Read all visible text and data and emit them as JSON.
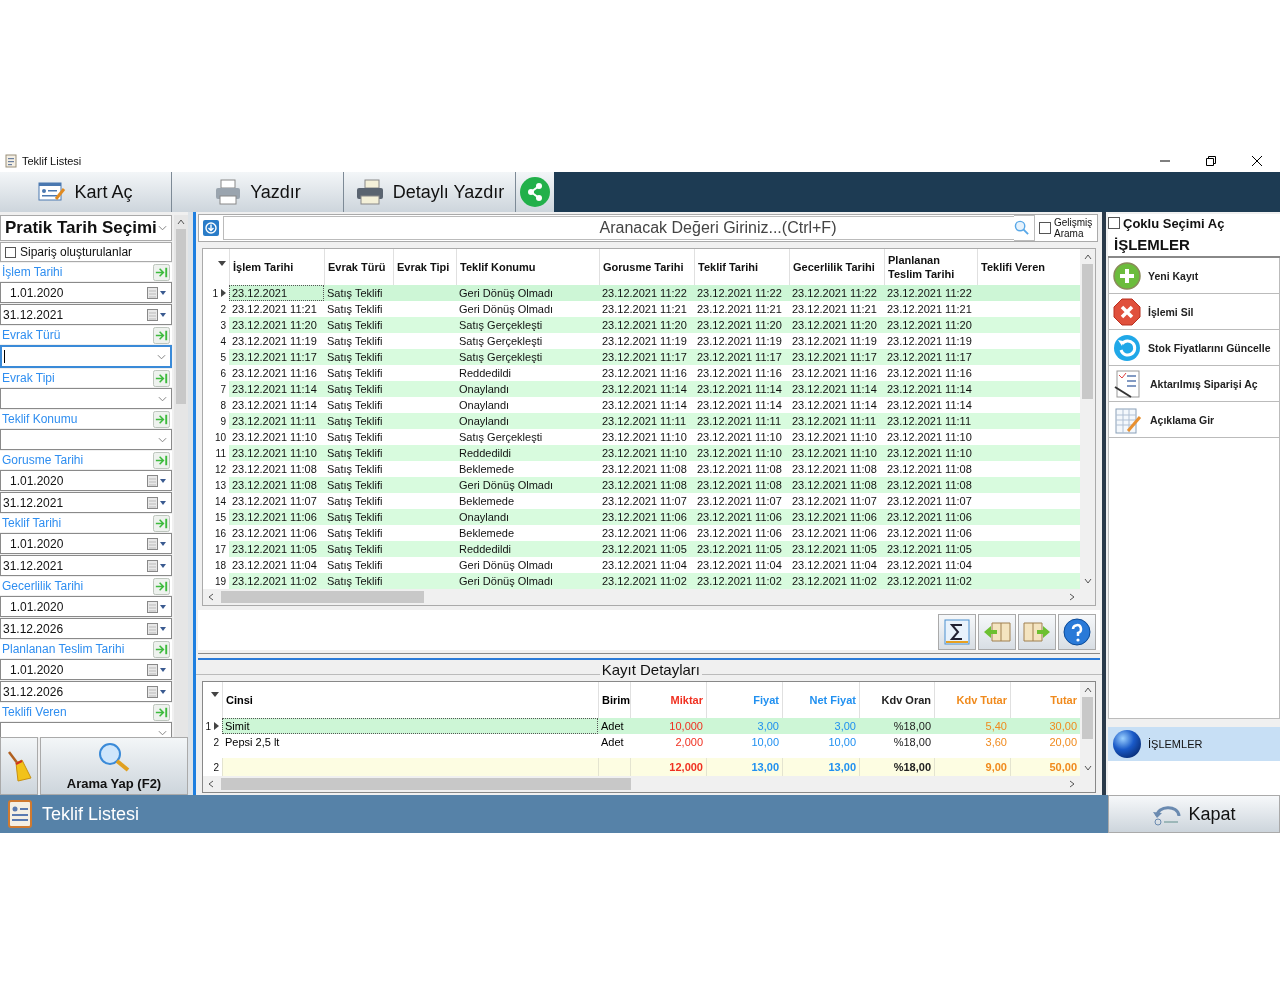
{
  "window": {
    "title": "Teklif Listesi"
  },
  "toolbar": [
    {
      "kind": "card",
      "label": "Kart Aç"
    },
    {
      "kind": "print",
      "label": "Yazdır"
    },
    {
      "kind": "detail_print",
      "label": "Detaylı Yazdır"
    },
    {
      "kind": "share"
    }
  ],
  "quick_date": {
    "label": "Pratik Tarih Seçimi"
  },
  "created_orders": {
    "label": "Sipariş oluşturulanlar",
    "checked": false
  },
  "filters": [
    {
      "label": "İşlem Tarihi",
      "fields": [
        {
          "kind": "date",
          "value": "1.01.2020",
          "focused": false
        },
        {
          "kind": "date",
          "value": "31.12.2021",
          "focused": false
        }
      ]
    },
    {
      "label": "Evrak Türü",
      "fields": [
        {
          "kind": "combo",
          "focused": true
        }
      ]
    },
    {
      "label": "Evrak Tipi",
      "fields": [
        {
          "kind": "combo",
          "focused": false
        }
      ]
    },
    {
      "label": "Teklif Konumu",
      "fields": [
        {
          "kind": "combo",
          "focused": false
        }
      ]
    },
    {
      "label": "Gorusme Tarihi",
      "fields": [
        {
          "kind": "date",
          "value": "1.01.2020",
          "focused": false
        },
        {
          "kind": "date",
          "value": "31.12.2021",
          "focused": false
        }
      ]
    },
    {
      "label": "Teklif Tarihi",
      "fields": [
        {
          "kind": "date",
          "value": "1.01.2020",
          "focused": false
        },
        {
          "kind": "date",
          "value": "31.12.2021",
          "focused": false
        }
      ]
    },
    {
      "label": "Gecerlilik Tarihi",
      "fields": [
        {
          "kind": "date",
          "value": "1.01.2020",
          "focused": false
        },
        {
          "kind": "date",
          "value": "31.12.2026",
          "focused": false
        }
      ]
    },
    {
      "label": "Planlanan Teslim Tarihi",
      "fields": [
        {
          "kind": "date",
          "value": "1.01.2020",
          "focused": false
        },
        {
          "kind": "date",
          "value": "31.12.2026",
          "focused": false
        }
      ]
    },
    {
      "label": "Teklifi Veren",
      "fields": [
        {
          "kind": "combo"
        }
      ]
    }
  ],
  "search_button": {
    "label": "Arama Yap (F2)"
  },
  "search": {
    "placeholder": "Aranacak Değeri Giriniz...(Ctrl+F)"
  },
  "advanced_search": {
    "label": "Gelişmiş Arama",
    "checked": false
  },
  "grid": {
    "columns": [
      "İşlem Tarihi",
      "Evrak Türü",
      "Evrak Tipi",
      "Teklif Konumu",
      "Gorusme Tarihi",
      "Teklif Tarihi",
      "Gecerlilik Tarihi",
      "Planlanan Teslim Tarihi",
      "Teklifi Veren"
    ],
    "rows": [
      {
        "no": "1",
        "selected": true,
        "cells": [
          "23.12.2021",
          "Satış Teklifi",
          null,
          "Geri Dönüş Olmadı",
          "23.12.2021 11:22",
          "23.12.2021 11:22",
          "23.12.2021 11:22",
          "23.12.2021 11:22",
          null
        ]
      },
      {
        "no": "2",
        "selected": false,
        "cells": [
          "23.12.2021 11:21",
          "Satış Teklifi",
          null,
          "Geri Dönüş Olmadı",
          "23.12.2021 11:21",
          "23.12.2021 11:21",
          "23.12.2021 11:21",
          "23.12.2021 11:21",
          null
        ]
      },
      {
        "no": "3",
        "selected": false,
        "cells": [
          "23.12.2021 11:20",
          "Satış Teklifi",
          null,
          "Satış Gerçekleşti",
          "23.12.2021 11:20",
          "23.12.2021 11:20",
          "23.12.2021 11:20",
          "23.12.2021 11:20",
          null
        ]
      },
      {
        "no": "4",
        "selected": false,
        "cells": [
          "23.12.2021 11:19",
          "Satış Teklifi",
          null,
          "Satış Gerçekleşti",
          "23.12.2021 11:19",
          "23.12.2021 11:19",
          "23.12.2021 11:19",
          "23.12.2021 11:19",
          null
        ]
      },
      {
        "no": "5",
        "selected": false,
        "cells": [
          "23.12.2021 11:17",
          "Satış Teklifi",
          null,
          "Satış Gerçekleşti",
          "23.12.2021 11:17",
          "23.12.2021 11:17",
          "23.12.2021 11:17",
          "23.12.2021 11:17",
          null
        ]
      },
      {
        "no": "6",
        "selected": false,
        "cells": [
          "23.12.2021 11:16",
          "Satış Teklifi",
          null,
          "Reddedildi",
          "23.12.2021 11:16",
          "23.12.2021 11:16",
          "23.12.2021 11:16",
          "23.12.2021 11:16",
          null
        ]
      },
      {
        "no": "7",
        "selected": false,
        "cells": [
          "23.12.2021 11:14",
          "Satış Teklifi",
          null,
          "Onaylandı",
          "23.12.2021 11:14",
          "23.12.2021 11:14",
          "23.12.2021 11:14",
          "23.12.2021 11:14",
          null
        ]
      },
      {
        "no": "8",
        "selected": false,
        "cells": [
          "23.12.2021 11:14",
          "Satış Teklifi",
          null,
          "Onaylandı",
          "23.12.2021 11:14",
          "23.12.2021 11:14",
          "23.12.2021 11:14",
          "23.12.2021 11:14",
          null
        ]
      },
      {
        "no": "9",
        "selected": false,
        "cells": [
          "23.12.2021 11:11",
          "Satış Teklifi",
          null,
          "Onaylandı",
          "23.12.2021 11:11",
          "23.12.2021 11:11",
          "23.12.2021 11:11",
          "23.12.2021 11:11",
          null
        ]
      },
      {
        "no": "10",
        "selected": false,
        "cells": [
          "23.12.2021 11:10",
          "Satış Teklifi",
          null,
          "Satış Gerçekleşti",
          "23.12.2021 11:10",
          "23.12.2021 11:10",
          "23.12.2021 11:10",
          "23.12.2021 11:10",
          null
        ]
      },
      {
        "no": "11",
        "selected": false,
        "cells": [
          "23.12.2021 11:10",
          "Satış Teklifi",
          null,
          "Reddedildi",
          "23.12.2021 11:10",
          "23.12.2021 11:10",
          "23.12.2021 11:10",
          "23.12.2021 11:10",
          null
        ]
      },
      {
        "no": "12",
        "selected": false,
        "cells": [
          "23.12.2021 11:08",
          "Satış Teklifi",
          null,
          "Beklemede",
          "23.12.2021 11:08",
          "23.12.2021 11:08",
          "23.12.2021 11:08",
          "23.12.2021 11:08",
          null
        ]
      },
      {
        "no": "13",
        "selected": false,
        "cells": [
          "23.12.2021 11:08",
          "Satış Teklifi",
          null,
          "Geri Dönüş Olmadı",
          "23.12.2021 11:08",
          "23.12.2021 11:08",
          "23.12.2021 11:08",
          "23.12.2021 11:08",
          null
        ]
      },
      {
        "no": "14",
        "selected": false,
        "cells": [
          "23.12.2021 11:07",
          "Satış Teklifi",
          null,
          "Beklemede",
          "23.12.2021 11:07",
          "23.12.2021 11:07",
          "23.12.2021 11:07",
          "23.12.2021 11:07",
          null
        ]
      },
      {
        "no": "15",
        "selected": false,
        "cells": [
          "23.12.2021 11:06",
          "Satış Teklifi",
          null,
          "Onaylandı",
          "23.12.2021 11:06",
          "23.12.2021 11:06",
          "23.12.2021 11:06",
          "23.12.2021 11:06",
          null
        ]
      },
      {
        "no": "16",
        "selected": false,
        "cells": [
          "23.12.2021 11:06",
          "Satış Teklifi",
          null,
          "Beklemede",
          "23.12.2021 11:06",
          "23.12.2021 11:06",
          "23.12.2021 11:06",
          "23.12.2021 11:06",
          null
        ]
      },
      {
        "no": "17",
        "selected": false,
        "cells": [
          "23.12.2021 11:05",
          "Satış Teklifi",
          null,
          "Reddedildi",
          "23.12.2021 11:05",
          "23.12.2021 11:05",
          "23.12.2021 11:05",
          "23.12.2021 11:05",
          null
        ]
      },
      {
        "no": "18",
        "selected": false,
        "cells": [
          "23.12.2021 11:04",
          "Satış Teklifi",
          null,
          "Geri Dönüş Olmadı",
          "23.12.2021 11:04",
          "23.12.2021 11:04",
          "23.12.2021 11:04",
          "23.12.2021 11:04",
          null
        ]
      },
      {
        "no": "19",
        "selected": false,
        "cells": [
          "23.12.2021 11:02",
          "Satış Teklifi",
          null,
          "Geri Dönüş Olmadı",
          "23.12.2021 11:02",
          "23.12.2021 11:02",
          "23.12.2021 11:02",
          "23.12.2021 11:02",
          null
        ]
      }
    ]
  },
  "grid_tools": [
    {
      "kind": "sum"
    },
    {
      "kind": "prev"
    },
    {
      "kind": "next"
    },
    {
      "kind": "help"
    }
  ],
  "details": {
    "title": "Kayıt Detayları",
    "columns": [
      {
        "label": "Cinsi",
        "kind": "text",
        "color": "#000000"
      },
      {
        "label": "Birim",
        "kind": "text",
        "color": "#000000"
      },
      {
        "label": "Miktar",
        "kind": "number",
        "color": "#f03020"
      },
      {
        "label": "Fiyat",
        "kind": "number",
        "color": "#2090f0"
      },
      {
        "label": "Net Fiyat",
        "kind": "number",
        "color": "#2090f0"
      },
      {
        "label": "Kdv Oran",
        "kind": "number",
        "color": "#222222"
      },
      {
        "label": "Kdv Tutar",
        "kind": "number",
        "color": "#f08a1c"
      },
      {
        "label": "Tutar",
        "kind": "number",
        "color": "#f08a1c"
      }
    ],
    "rows": [
      {
        "no": "1",
        "selected": true,
        "cells": [
          "Simit",
          "Adet",
          "10,000",
          "3,00",
          "3,00",
          "%18,00",
          "5,40",
          "30,00"
        ]
      },
      {
        "no": "2",
        "selected": false,
        "cells": [
          "Pepsi 2,5 lt",
          "Adet",
          "2,000",
          "10,00",
          "10,00",
          "%18,00",
          "3,60",
          "20,00"
        ]
      }
    ],
    "footer": {
      "count": "2",
      "cells": [
        null,
        null,
        "12,000",
        "13,00",
        "13,00",
        "%18,00",
        "9,00",
        "50,00"
      ]
    }
  },
  "multi_select": {
    "label": "Çoklu Seçimi Aç",
    "checked": false
  },
  "actions": {
    "title": "İŞLEMLER",
    "items": [
      {
        "kind": "add",
        "label": "Yeni Kayıt"
      },
      {
        "kind": "delete",
        "label": "İşlemi Sil"
      },
      {
        "kind": "refresh",
        "label": "Stok Fiyatlarını Güncelle"
      },
      {
        "kind": "transfer",
        "label": "Aktarılmış Siparişi Aç"
      },
      {
        "kind": "note",
        "label": "Açıklama Gir"
      }
    ]
  },
  "nav": [
    {
      "label": "İŞLEMLER",
      "selected": true
    }
  ],
  "status_bar": {
    "title": "Teklif Listesi"
  },
  "close_button": {
    "label": "Kapat"
  }
}
